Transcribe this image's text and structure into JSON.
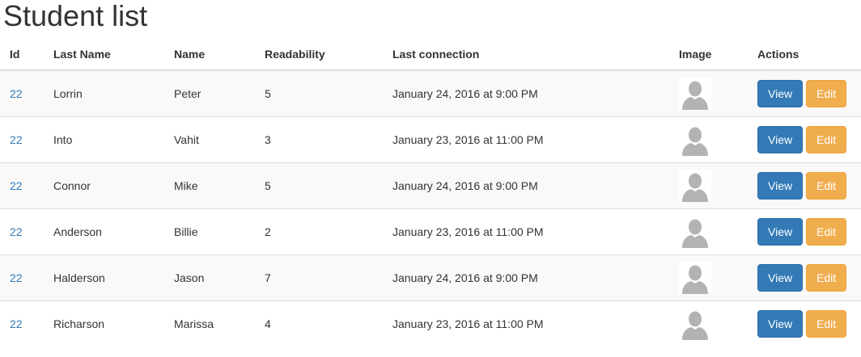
{
  "page": {
    "title": "Student list"
  },
  "table": {
    "headers": {
      "id": "Id",
      "last_name": "Last Name",
      "name": "Name",
      "readability": "Readability",
      "last_connection": "Last connection",
      "image": "Image",
      "actions": "Actions"
    },
    "rows": [
      {
        "id": "22",
        "last_name": "Lorrin",
        "name": "Peter",
        "readability": "5",
        "last_connection": "January 24, 2016 at 9:00 PM",
        "image_icon": "user-avatar-icon",
        "view_label": "View",
        "edit_label": "Edit"
      },
      {
        "id": "22",
        "last_name": "Into",
        "name": "Vahit",
        "readability": "3",
        "last_connection": "January 23, 2016 at 11:00 PM",
        "image_icon": "user-avatar-icon",
        "view_label": "View",
        "edit_label": "Edit"
      },
      {
        "id": "22",
        "last_name": "Connor",
        "name": "Mike",
        "readability": "5",
        "last_connection": "January 24, 2016 at 9:00 PM",
        "image_icon": "user-avatar-icon",
        "view_label": "View",
        "edit_label": "Edit"
      },
      {
        "id": "22",
        "last_name": "Anderson",
        "name": "Billie",
        "readability": "2",
        "last_connection": "January 23, 2016 at 11:00 PM",
        "image_icon": "user-avatar-icon",
        "view_label": "View",
        "edit_label": "Edit"
      },
      {
        "id": "22",
        "last_name": "Halderson",
        "name": "Jason",
        "readability": "7",
        "last_connection": "January 24, 2016 at 9:00 PM",
        "image_icon": "user-avatar-icon",
        "view_label": "View",
        "edit_label": "Edit"
      },
      {
        "id": "22",
        "last_name": "Richarson",
        "name": "Marissa",
        "readability": "4",
        "last_connection": "January 23, 2016 at 11:00 PM",
        "image_icon": "user-avatar-icon",
        "view_label": "View",
        "edit_label": "Edit"
      }
    ]
  },
  "colors": {
    "link": "#337ab7",
    "view_button": "#337ab7",
    "edit_button": "#f0ad4e",
    "striped_row": "#f9f9f9",
    "avatar_silhouette": "#b3b3b3"
  }
}
